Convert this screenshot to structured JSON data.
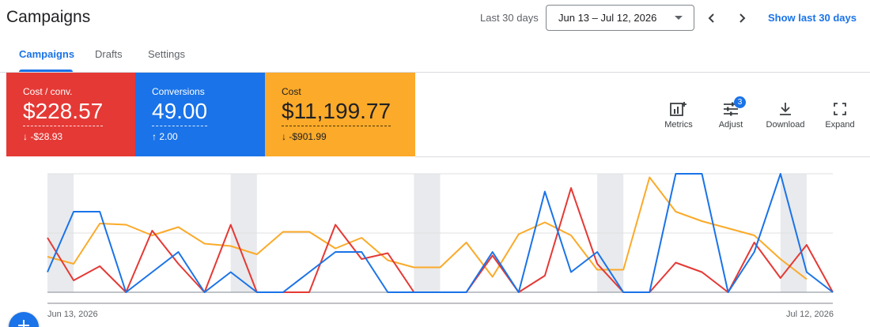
{
  "header": {
    "title": "Campaigns",
    "range_label": "Last 30 days",
    "date_range": "Jun 13 – Jul 12, 2026",
    "show_last": "Show last 30 days"
  },
  "tabs": [
    {
      "label": "Campaigns",
      "active": true
    },
    {
      "label": "Drafts",
      "active": false
    },
    {
      "label": "Settings",
      "active": false
    }
  ],
  "cards": [
    {
      "label": "Cost / conv.",
      "value": "$228.57",
      "delta": "-$28.93",
      "direction": "down",
      "color": "#e53935"
    },
    {
      "label": "Conversions",
      "value": "49.00",
      "delta": "2.00",
      "direction": "up",
      "color": "#1a73e8"
    },
    {
      "label": "Cost",
      "value": "$11,199.77",
      "delta": "-$901.99",
      "direction": "down",
      "color": "#fbaa29"
    }
  ],
  "tools": [
    {
      "label": "Metrics",
      "icon": "bar-chart-add-icon"
    },
    {
      "label": "Adjust",
      "icon": "tune-icon",
      "badge": "3"
    },
    {
      "label": "Download",
      "icon": "download-icon"
    },
    {
      "label": "Expand",
      "icon": "fullscreen-icon"
    }
  ],
  "colors": {
    "primary": "#1a73e8",
    "red": "#e53935",
    "blue": "#1a73e8",
    "orange": "#fbaa29",
    "weekend": "#e8eaed"
  },
  "chart_data": {
    "type": "line",
    "x_start_label": "Jun 13, 2026",
    "x_end_label": "Jul 12, 2026",
    "ylim": [
      0,
      100
    ],
    "weekend_bands": [
      [
        0,
        1
      ],
      [
        7,
        8
      ],
      [
        14,
        15
      ],
      [
        21,
        22
      ],
      [
        28,
        29
      ]
    ],
    "series": [
      {
        "color": "#1a73e8",
        "values": [
          17,
          68,
          68,
          0,
          17,
          34,
          0,
          17,
          0,
          0,
          17,
          34,
          34,
          0,
          0,
          0,
          0,
          34,
          0,
          85,
          17,
          34,
          0,
          0,
          100,
          100,
          0,
          34,
          100,
          17,
          0
        ]
      },
      {
        "color": "#e53935",
        "values": [
          46,
          10,
          22,
          0,
          52,
          24,
          0,
          57,
          0,
          0,
          0,
          57,
          28,
          33,
          0,
          0,
          0,
          31,
          0,
          14,
          88,
          24,
          0,
          0,
          25,
          17,
          0,
          42,
          12,
          40,
          0
        ]
      },
      {
        "color": "#fbaa29",
        "values": [
          30,
          24,
          58,
          57,
          48,
          55,
          41,
          39,
          32,
          51,
          51,
          37,
          46,
          27,
          21,
          21,
          42,
          13,
          49,
          59,
          48,
          19,
          19,
          97,
          68,
          60,
          54,
          48,
          28,
          11
        ]
      }
    ]
  }
}
